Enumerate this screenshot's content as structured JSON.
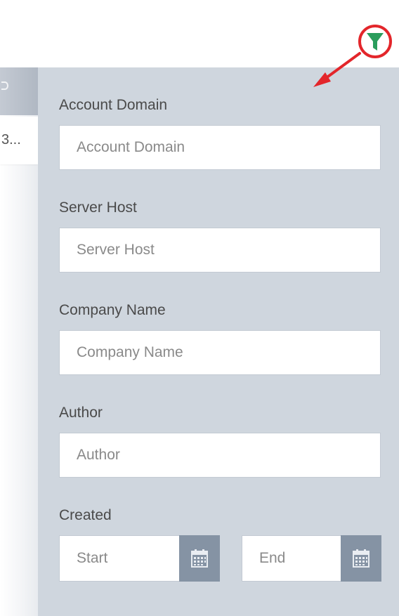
{
  "background_table": {
    "partial_cell_text": "3..."
  },
  "filter": {
    "icon": "funnel-icon",
    "accent_color": "#2a9d5c",
    "annotation_color": "#e3262b",
    "fields": [
      {
        "label": "Account Domain",
        "placeholder": "Account Domain"
      },
      {
        "label": "Server Host",
        "placeholder": "Server Host"
      },
      {
        "label": "Company Name",
        "placeholder": "Company Name"
      },
      {
        "label": "Author",
        "placeholder": "Author"
      }
    ],
    "created": {
      "label": "Created",
      "start_placeholder": "Start",
      "end_placeholder": "End",
      "calendar_icon": "calendar-icon"
    }
  }
}
